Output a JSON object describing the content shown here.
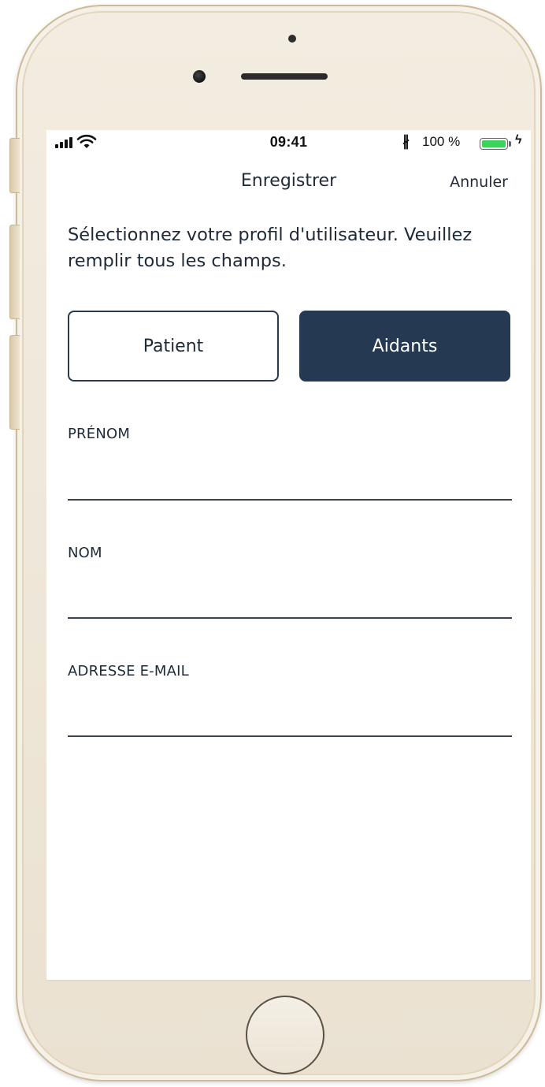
{
  "status_bar": {
    "time": "09:41",
    "battery_percent": "100 %",
    "bluetooth_icon": "bluetooth-icon",
    "wifi_icon": "wifi-icon",
    "signal_icon": "signal-icon",
    "charging_icon": "charging-icon",
    "battery_color": "#3cd35b"
  },
  "nav": {
    "title": "Enregistrer",
    "cancel_label": "Annuler"
  },
  "intro": {
    "text": "Sélectionnez votre profil d'utilisateur. Veuillez remplir tous les champs."
  },
  "profile_selector": {
    "options": [
      {
        "label": "Patient",
        "selected": false
      },
      {
        "label": "Aidants",
        "selected": true
      }
    ],
    "selected_color": "#253a52"
  },
  "form": {
    "fields": [
      {
        "label": "PRÉNOM",
        "value": ""
      },
      {
        "label": "NOM",
        "value": ""
      },
      {
        "label": "ADRESSE E-MAIL",
        "value": ""
      }
    ]
  }
}
